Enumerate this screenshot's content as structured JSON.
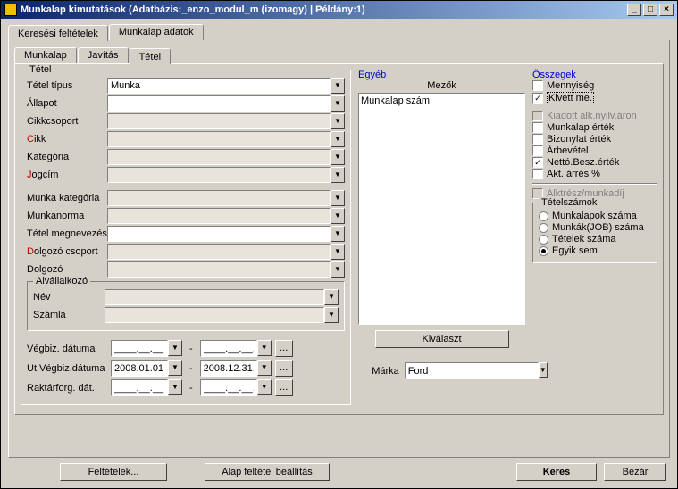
{
  "title": "Munkalap kimutatások   (Adatbázis:_enzo_modul_m (izomagy)  | Példány:1)",
  "tabs_top": {
    "t1": "Keresési feltételek",
    "t2": "Munkalap adatok"
  },
  "tabs_inner": {
    "t1": "Munkalap",
    "t2": "Javítás",
    "t3": "Tétel"
  },
  "group_tetel": "Tétel",
  "labels": {
    "tetel_tipus": "Tétel típus",
    "allapot": "Állapot",
    "cikkcsoport": "Cikkcsoport",
    "cikk_pre": "C",
    "cikk_rest": "ikk",
    "kategoria": "Kategória",
    "jogcim_pre": "J",
    "jogcim_rest": "ogcím",
    "munka_kat": "Munka kategória",
    "munkanorma": "Munkanorma",
    "tetel_megnev": "Tétel megnevezés",
    "dolgozo_cs_pre": "D",
    "dolgozo_cs_rest": "olgozó csoport",
    "dolgozo": "Dolgozó"
  },
  "values": {
    "tetel_tipus": "Munka"
  },
  "group_alval": "Alvállalkozó",
  "alval": {
    "nev": "Név",
    "szamla": "Számla"
  },
  "dates": {
    "vegbiz": "Végbiz. dátuma",
    "utvegbiz": "Ut.Végbiz.dátuma",
    "raktar": "Raktárforg. dát.",
    "d_from": "2008.01.01.",
    "d_to": "2008.12.31.",
    "blank": "____.__.__.",
    "underscore": "__"
  },
  "egyeb": "Egyéb",
  "mezok": "Mezők",
  "mezok_item": "Munkalap szám",
  "kivalaszt": "Kiválaszt",
  "marka_label": "Márka",
  "marka_value": "Ford",
  "osszegek": {
    "title": "Összegek",
    "mennyiseg": "Mennyiség",
    "kivett": "Kivett me.",
    "kiadott": "Kiadott alk.nyilv.áron",
    "munkalap_ertek": "Munkalap érték",
    "bizonylat_ertek": "Bizonylat érték",
    "arbevetel": "Árbevétel",
    "netto": "Nettó.Besz.érték",
    "akt_arres": "Akt. árrés %",
    "alkatresz": "Alktrész/munkadíj"
  },
  "tetelszamok": {
    "title": "Tételszámok",
    "r1": "Munkalapok száma",
    "r2": "Munkák(JOB) száma",
    "r3": "Tételek száma",
    "r4": "Egyik sem"
  },
  "buttons": {
    "feltetelek": "Feltételek...",
    "alap": "Alap feltétel beállítás",
    "keres": "Keres",
    "bezar": "Bezár",
    "dots": "..."
  }
}
